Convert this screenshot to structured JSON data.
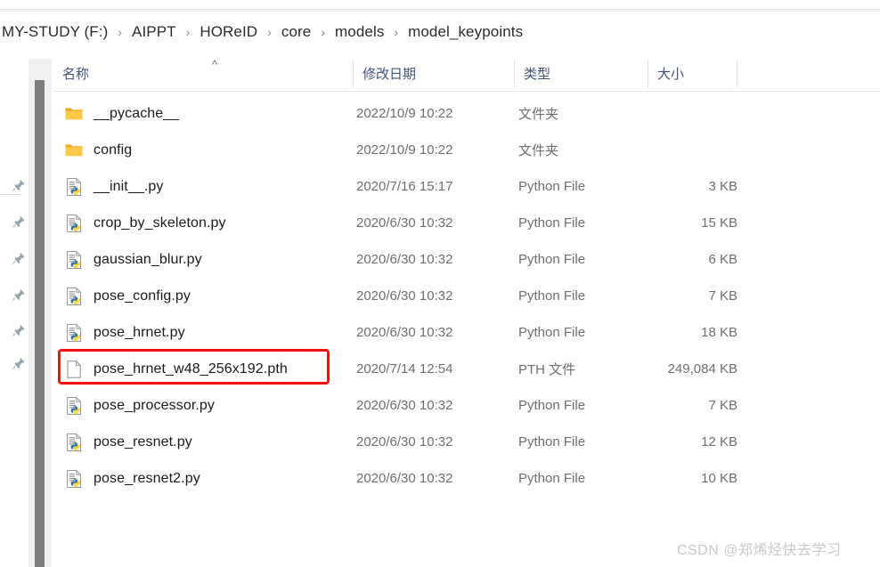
{
  "breadcrumb": {
    "separator": "›",
    "items": [
      "MY-STUDY (F:)",
      "AIPPT",
      "HOReID",
      "core",
      "models",
      "model_keypoints"
    ]
  },
  "navigation_pane": {
    "pin_icon_name": "pin-icon",
    "pin_count": 6
  },
  "columns": {
    "name": "名称",
    "date_modified": "修改日期",
    "type": "类型",
    "size": "大小",
    "sort_indicator": "^",
    "sort_column": "名称",
    "sort_direction": "ascending"
  },
  "files": [
    {
      "name": "__pycache__",
      "date_modified": "2022/10/9 10:22",
      "type": "文件夹",
      "size": "",
      "icon": "folder-icon",
      "highlighted": false
    },
    {
      "name": "config",
      "date_modified": "2022/10/9 10:22",
      "type": "文件夹",
      "size": "",
      "icon": "folder-icon",
      "highlighted": false
    },
    {
      "name": "__init__.py",
      "date_modified": "2020/7/16 15:17",
      "type": "Python File",
      "size": "3 KB",
      "icon": "python-file-icon",
      "highlighted": false
    },
    {
      "name": "crop_by_skeleton.py",
      "date_modified": "2020/6/30 10:32",
      "type": "Python File",
      "size": "15 KB",
      "icon": "python-file-icon",
      "highlighted": false
    },
    {
      "name": "gaussian_blur.py",
      "date_modified": "2020/6/30 10:32",
      "type": "Python File",
      "size": "6 KB",
      "icon": "python-file-icon",
      "highlighted": false
    },
    {
      "name": "pose_config.py",
      "date_modified": "2020/6/30 10:32",
      "type": "Python File",
      "size": "7 KB",
      "icon": "python-file-icon",
      "highlighted": false
    },
    {
      "name": "pose_hrnet.py",
      "date_modified": "2020/6/30 10:32",
      "type": "Python File",
      "size": "18 KB",
      "icon": "python-file-icon",
      "highlighted": false
    },
    {
      "name": "pose_hrnet_w48_256x192.pth",
      "date_modified": "2020/7/14 12:54",
      "type": "PTH 文件",
      "size": "249,084 KB",
      "icon": "generic-file-icon",
      "highlighted": true
    },
    {
      "name": "pose_processor.py",
      "date_modified": "2020/6/30 10:32",
      "type": "Python File",
      "size": "7 KB",
      "icon": "python-file-icon",
      "highlighted": false
    },
    {
      "name": "pose_resnet.py",
      "date_modified": "2020/6/30 10:32",
      "type": "Python File",
      "size": "12 KB",
      "icon": "python-file-icon",
      "highlighted": false
    },
    {
      "name": "pose_resnet2.py",
      "date_modified": "2020/6/30 10:32",
      "type": "Python File",
      "size": "10 KB",
      "icon": "python-file-icon",
      "highlighted": false
    }
  ],
  "highlight": {
    "color": "#fc0d0d",
    "target_file": "pose_hrnet_w48_256x192.pth"
  },
  "watermark": {
    "text": "CSDN @郑烯烃快去学习",
    "color": "#c9c9c9"
  },
  "colors": {
    "header_text": "#43537a",
    "file_name_text": "#1b1b1b",
    "meta_text": "#6f6f6f",
    "folder_icon": "#ffc846",
    "scrollbar_thumb": "#7e7e7e",
    "scrollbar_track": "#f0f0f0"
  }
}
